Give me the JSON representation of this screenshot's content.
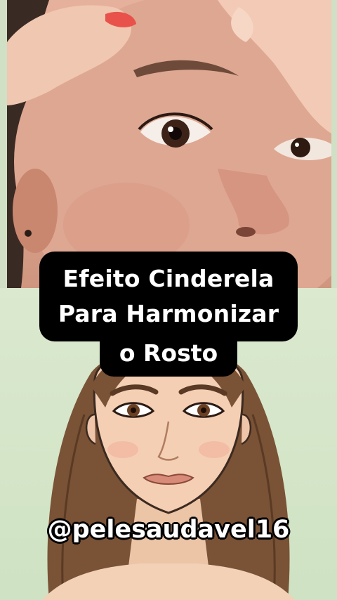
{
  "caption": {
    "line1": "Efeito Cinderela",
    "line2": "Para Harmonizar",
    "line3": "o Rosto"
  },
  "handle": "@pelesaudavel16",
  "colors": {
    "background": "#cfe0c4",
    "caption_bg": "#000000",
    "caption_text": "#ffffff",
    "skin_photo": "#dba590",
    "hair_illustration": "#7a5236"
  }
}
